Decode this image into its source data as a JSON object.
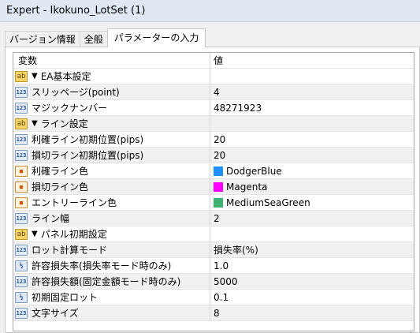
{
  "window": {
    "title": "Expert - Ikokuno_LotSet (1)"
  },
  "tabs": [
    {
      "label": "バージョン情報"
    },
    {
      "label": "全般"
    },
    {
      "label": "パラメーターの入力"
    }
  ],
  "grid": {
    "headers": {
      "variable": "変数",
      "value": "値"
    },
    "rows": [
      {
        "type": "group",
        "icon": "ab",
        "label": "EA基本設定",
        "value": ""
      },
      {
        "type": "int",
        "icon": "123",
        "label": "スリッページ(point)",
        "value": "4"
      },
      {
        "type": "int",
        "icon": "123",
        "label": "マジックナンバー",
        "value": "48271923"
      },
      {
        "type": "group",
        "icon": "ab",
        "label": "ライン設定",
        "value": ""
      },
      {
        "type": "int",
        "icon": "123",
        "label": "利確ライン初期位置(pips)",
        "value": "20"
      },
      {
        "type": "int",
        "icon": "123",
        "label": "損切ライン初期位置(pips)",
        "value": "20"
      },
      {
        "type": "color",
        "icon": "palette",
        "label": "利確ライン色",
        "value": "DodgerBlue",
        "swatch": "#1e90ff"
      },
      {
        "type": "color",
        "icon": "palette",
        "label": "損切ライン色",
        "value": "Magenta",
        "swatch": "#ff00ff"
      },
      {
        "type": "color",
        "icon": "palette",
        "label": "エントリーライン色",
        "value": "MediumSeaGreen",
        "swatch": "#3cb371"
      },
      {
        "type": "int",
        "icon": "123",
        "label": "ライン幅",
        "value": "2"
      },
      {
        "type": "group",
        "icon": "ab",
        "label": "パネル初期設定",
        "value": ""
      },
      {
        "type": "int",
        "icon": "123",
        "label": "ロット計算モード",
        "value": "損失率(%)"
      },
      {
        "type": "double",
        "icon": "1/2",
        "label": "許容損失率(損失率モード時のみ)",
        "value": "1.0"
      },
      {
        "type": "int",
        "icon": "123",
        "label": "許容損失額(固定金額モード時のみ)",
        "value": "5000"
      },
      {
        "type": "double",
        "icon": "1/2",
        "label": "初期固定ロット",
        "value": "0.1"
      },
      {
        "type": "int",
        "icon": "123",
        "label": "文字サイズ",
        "value": "8"
      }
    ]
  }
}
